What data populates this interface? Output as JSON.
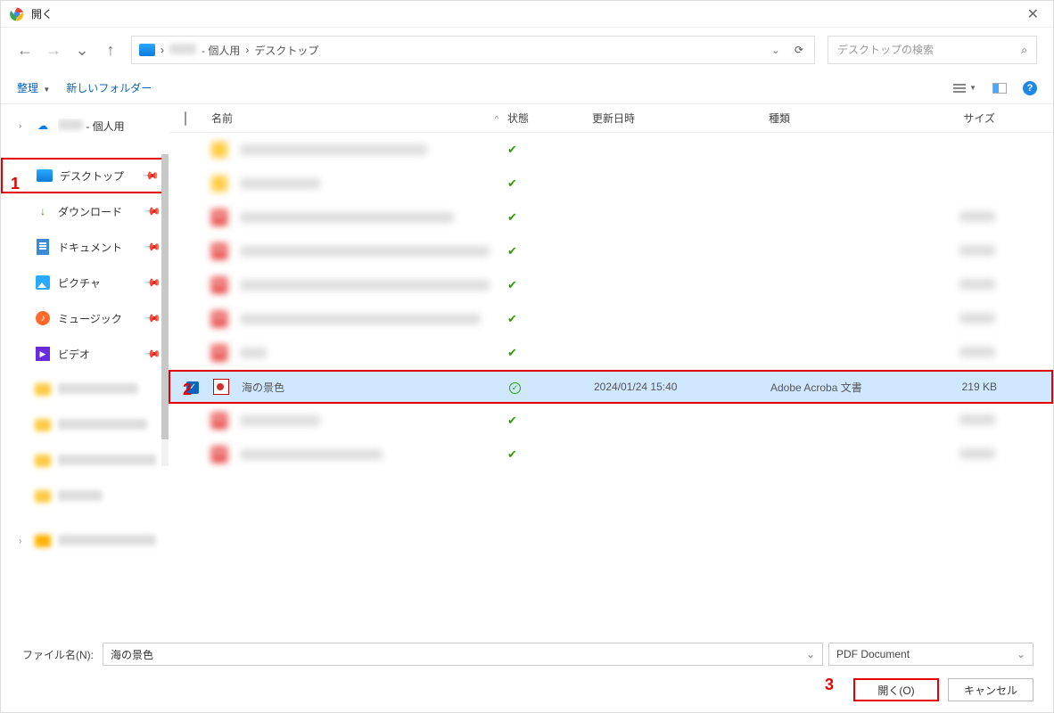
{
  "window": {
    "title": "開く",
    "close_x": "✕"
  },
  "nav": {
    "back": "←",
    "fwd": "→",
    "recent": "⌄",
    "up": "↑"
  },
  "breadcrumb": {
    "mid_suffix": " - 個人用",
    "last": "デスクトップ",
    "sep": "›"
  },
  "addrbar": {
    "dd": "⌄",
    "refresh": "⟳"
  },
  "search": {
    "placeholder": "デスクトップの検索",
    "icon": "⌕"
  },
  "toolbar": {
    "organize": "整理",
    "newfolder": "新しいフォルダー",
    "caret": "▼",
    "help": "?"
  },
  "sidebar": {
    "root_suffix": " - 個人用",
    "items": [
      {
        "label": "デスクトップ"
      },
      {
        "label": "ダウンロード"
      },
      {
        "label": "ドキュメント"
      },
      {
        "label": "ピクチャ"
      },
      {
        "label": "ミュージック"
      },
      {
        "label": "ビデオ"
      }
    ]
  },
  "columns": {
    "name": "名前",
    "state": "状態",
    "date": "更新日時",
    "type": "種類",
    "size": "サイズ"
  },
  "selected_file": {
    "name": "海の景色",
    "date": "2024/01/24 15:40",
    "type": "Adobe Acroba 文書",
    "size": "219 KB",
    "check": "✓",
    "sync": "✓"
  },
  "footer": {
    "filename_label": "ファイル名(N):",
    "filename_value": "海の景色",
    "filetype_value": "PDF Document",
    "open_label": "開く(O)",
    "cancel_label": "キャンセル"
  },
  "anno": {
    "a1": "1",
    "a2": "2",
    "a3": "3"
  }
}
